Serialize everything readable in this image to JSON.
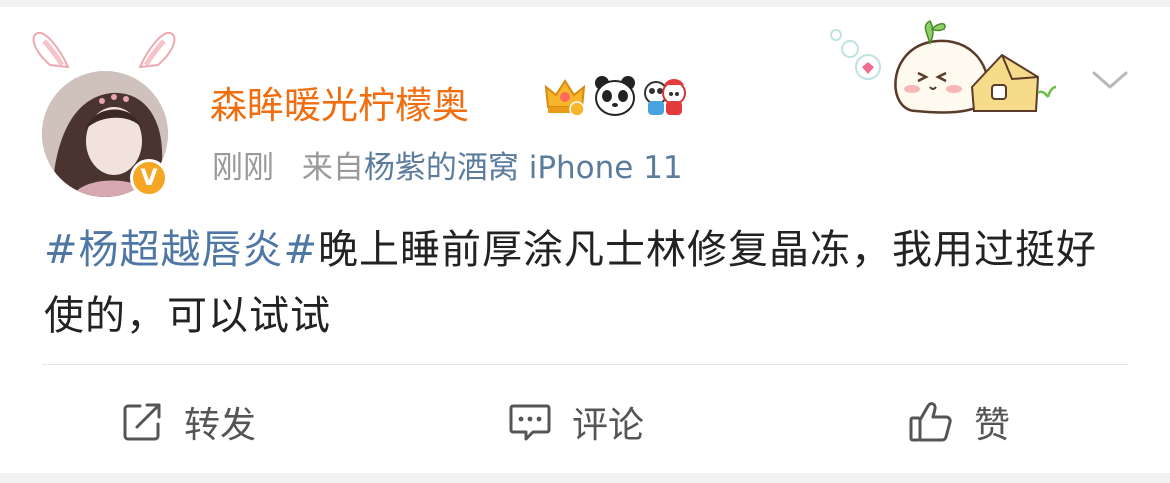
{
  "post": {
    "username": "森眸暖光柠檬奥",
    "time": "刚刚",
    "from_prefix": "来自",
    "source": "杨紫的酒窝 iPhone 11",
    "content": {
      "hashtag": "#杨超越唇炎#",
      "text": "晚上睡前厚涂凡士林修复晶冻，我用过挺好使的，可以试试"
    },
    "verified_mark": "V",
    "badges": [
      "crown-badge-icon",
      "panda-icon",
      "panda-mascot-icon"
    ]
  },
  "actions": {
    "repost_label": "转发",
    "comment_label": "评论",
    "like_label": "赞"
  },
  "colors": {
    "username": "#f26d0e",
    "hashtag": "#4e77a4",
    "source": "#5b7c9d",
    "meta": "#999999",
    "verified": "#f6a623"
  }
}
